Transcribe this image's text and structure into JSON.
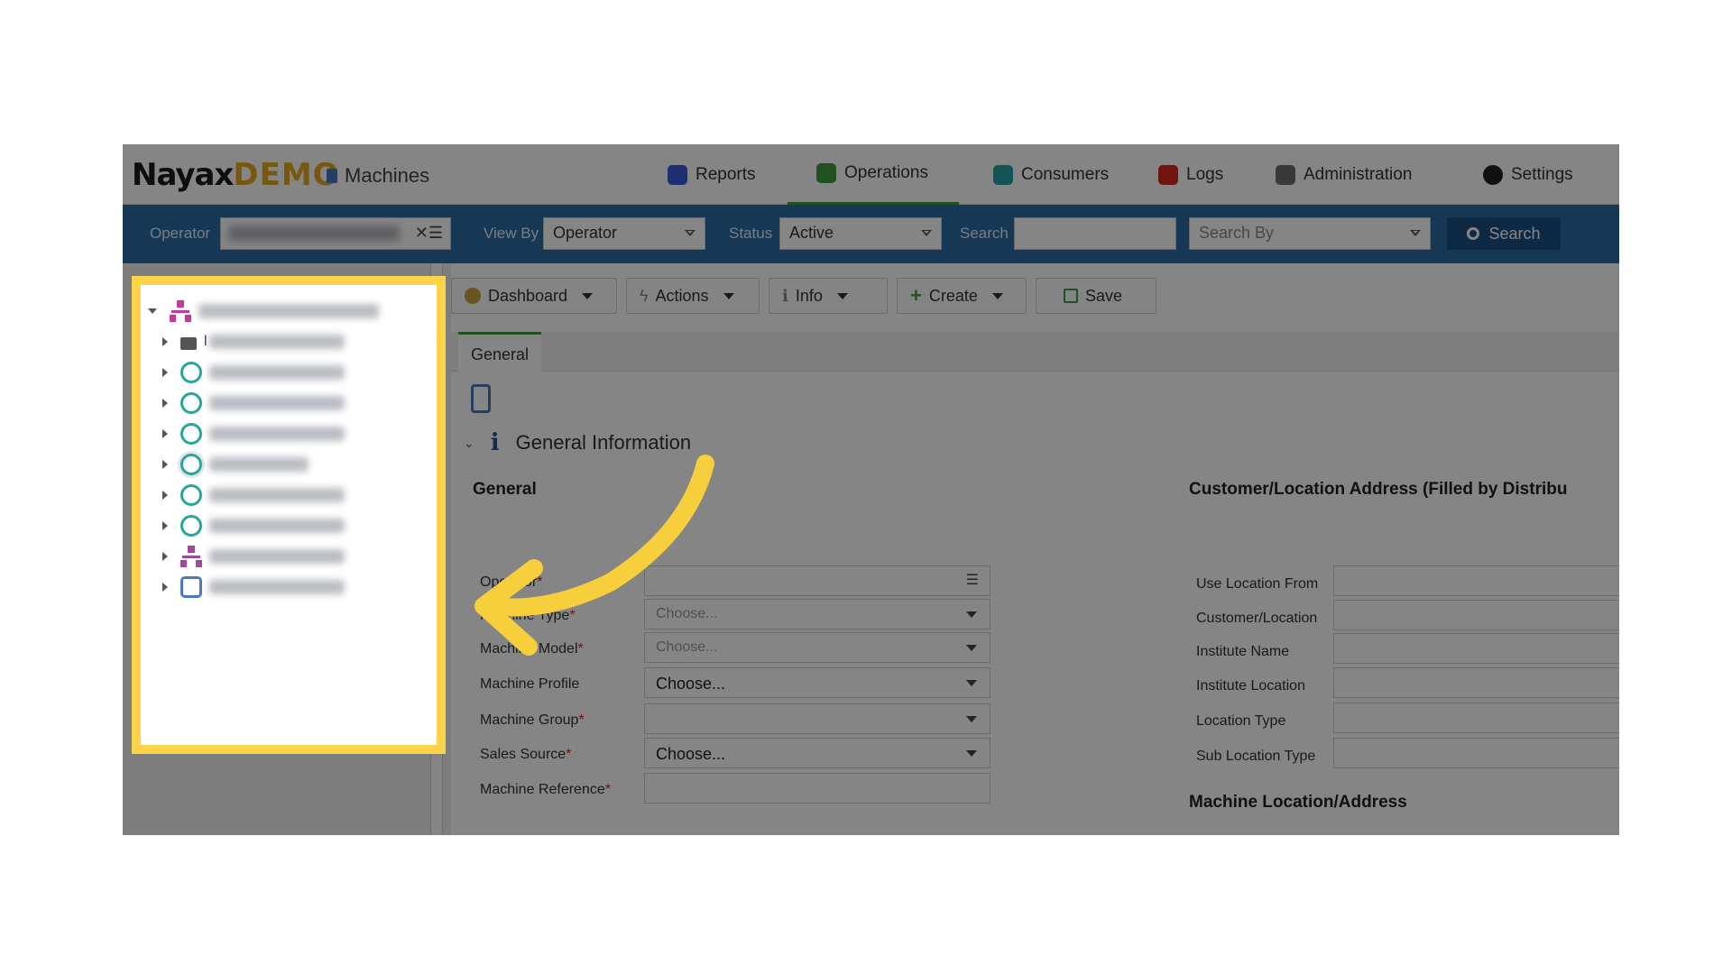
{
  "header": {
    "logo_main": "Nayax",
    "logo_demo": "DEMO",
    "module": "Machines",
    "nav": [
      {
        "label": "Reports",
        "icon": "reports-icon",
        "color": "#3b5bd8"
      },
      {
        "label": "Operations",
        "icon": "operations-icon",
        "color": "#3e9b3c"
      },
      {
        "label": "Consumers",
        "icon": "consumers-icon",
        "color": "#28a0a8"
      },
      {
        "label": "Logs",
        "icon": "logs-icon",
        "color": "#d9261c"
      },
      {
        "label": "Administration",
        "icon": "administration-icon",
        "color": "#6d6d6d"
      },
      {
        "label": "Settings",
        "icon": "settings-icon",
        "color": "#222222"
      }
    ],
    "active_nav": "Operations"
  },
  "toolbar": {
    "operator_label": "Operator",
    "viewby_label": "View By",
    "viewby_value": "Operator",
    "status_label": "Status",
    "status_value": "Active",
    "search_label": "Search",
    "searchby_placeholder": "Search By",
    "search_button": "Search"
  },
  "actions": {
    "dashboard": "Dashboard",
    "actions": "Actions",
    "info": "Info",
    "create": "Create",
    "save": "Save"
  },
  "tabs": [
    "General"
  ],
  "section": {
    "title": "General Information",
    "left_heading": "General",
    "right_heading": "Customer/Location Address (Filled by Distribu",
    "right_heading2": "Machine Location/Address"
  },
  "fields_left": [
    {
      "label": "Operator",
      "required": true,
      "value": ""
    },
    {
      "label": "Machine Type",
      "required": true,
      "value": "Choose..."
    },
    {
      "label": "Machine Model",
      "required": true,
      "value": "Choose..."
    },
    {
      "label": "Machine Profile",
      "required": false,
      "value": "Choose..."
    },
    {
      "label": "Machine Group",
      "required": true,
      "value": ""
    },
    {
      "label": "Sales Source",
      "required": true,
      "value": "Choose..."
    },
    {
      "label": "Machine Reference",
      "required": true,
      "value": ""
    }
  ],
  "fields_right": [
    {
      "label": "Use Location From"
    },
    {
      "label": "Customer/Location"
    },
    {
      "label": "Institute Name"
    },
    {
      "label": "Institute Location"
    },
    {
      "label": "Location Type"
    },
    {
      "label": "Sub Location Type"
    }
  ],
  "required_mark": "*",
  "tree": {
    "first_child_letter": "l",
    "nodes": [
      {
        "icon": "org-tree-icon",
        "color": "#c43a9b"
      },
      {
        "icon": "folder-icon",
        "color": "#555555"
      },
      {
        "icon": "operator-icon",
        "color": "#26a69a"
      },
      {
        "icon": "operator-icon",
        "color": "#26a69a"
      },
      {
        "icon": "operator-icon",
        "color": "#26a69a"
      },
      {
        "icon": "operator-icon",
        "color": "#26a69a"
      },
      {
        "icon": "operator-icon",
        "color": "#26a69a"
      },
      {
        "icon": "operator-icon",
        "color": "#26a69a"
      },
      {
        "icon": "org-tree-icon",
        "color": "#a0489b"
      },
      {
        "icon": "bag-icon",
        "color": "#4a78c2"
      }
    ]
  },
  "colors": {
    "highlight": "#fdd34a",
    "toolbar": "#2d6ca1",
    "arrow": "#f7cf3d"
  }
}
